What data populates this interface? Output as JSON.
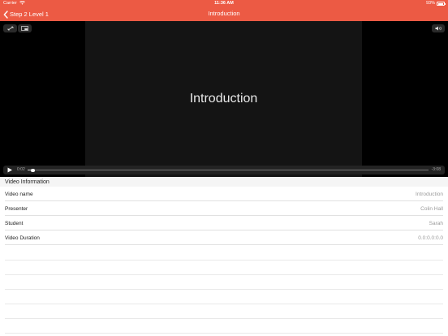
{
  "status_bar": {
    "carrier": "Carrier",
    "time": "11:36 AM",
    "battery_percent": "93%"
  },
  "nav": {
    "back_label": "Step 2 Level 1",
    "title": "Introduction"
  },
  "video": {
    "caption": "Introduction",
    "elapsed": "0:02",
    "remaining": "-3:08",
    "progress_fraction": 0.01
  },
  "video_info": {
    "section_title": "Video Information",
    "rows": [
      {
        "label": "Video name",
        "value": "Introduction"
      },
      {
        "label": "Presenter",
        "value": "Colin Hall"
      },
      {
        "label": "Student",
        "value": "Sarah"
      },
      {
        "label": "Video Duration",
        "value": "0.0:0.0:0.0"
      }
    ]
  },
  "colors": {
    "accent": "#ec5a44",
    "player_background": "#000000"
  },
  "icons": [
    "wifi-icon",
    "battery-icon",
    "chevron-left-icon",
    "fullscreen-icon",
    "picture-in-picture-icon",
    "volume-icon",
    "play-icon"
  ]
}
